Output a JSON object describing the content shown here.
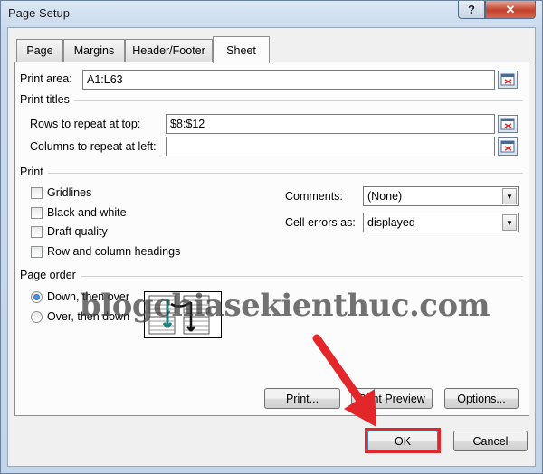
{
  "window": {
    "title": "Page Setup",
    "help_label": "?",
    "close_label": "✕"
  },
  "tabs": [
    {
      "label": "Page"
    },
    {
      "label": "Margins"
    },
    {
      "label": "Header/Footer"
    },
    {
      "label": "Sheet",
      "active": true
    }
  ],
  "print_area": {
    "label": "Print area:",
    "value": "A1:L63"
  },
  "print_titles": {
    "heading": "Print titles",
    "rows_label": "Rows to repeat at top:",
    "rows_value": "$8:$12",
    "columns_label": "Columns to repeat at left:",
    "columns_value": ""
  },
  "print": {
    "heading": "Print",
    "options": [
      {
        "label": "Gridlines",
        "checked": false
      },
      {
        "label": "Black and white",
        "checked": false
      },
      {
        "label": "Draft quality",
        "checked": false
      },
      {
        "label": "Row and column headings",
        "checked": false
      }
    ],
    "comments_label": "Comments:",
    "comments_value": "(None)",
    "cell_errors_label": "Cell errors as:",
    "cell_errors_value": "displayed"
  },
  "page_order": {
    "heading": "Page order",
    "options": [
      {
        "label": "Down, then over",
        "selected": true
      },
      {
        "label": "Over, then down",
        "selected": false
      }
    ]
  },
  "buttons": {
    "print": "Print...",
    "print_preview": "Print Preview",
    "options": "Options...",
    "ok": "OK",
    "cancel": "Cancel"
  },
  "watermark": "blogchiasekienthuc.com",
  "colors": {
    "annotation_red": "#e2262a",
    "title_bar": "#c8d9ec",
    "close_button": "#c4412b"
  }
}
